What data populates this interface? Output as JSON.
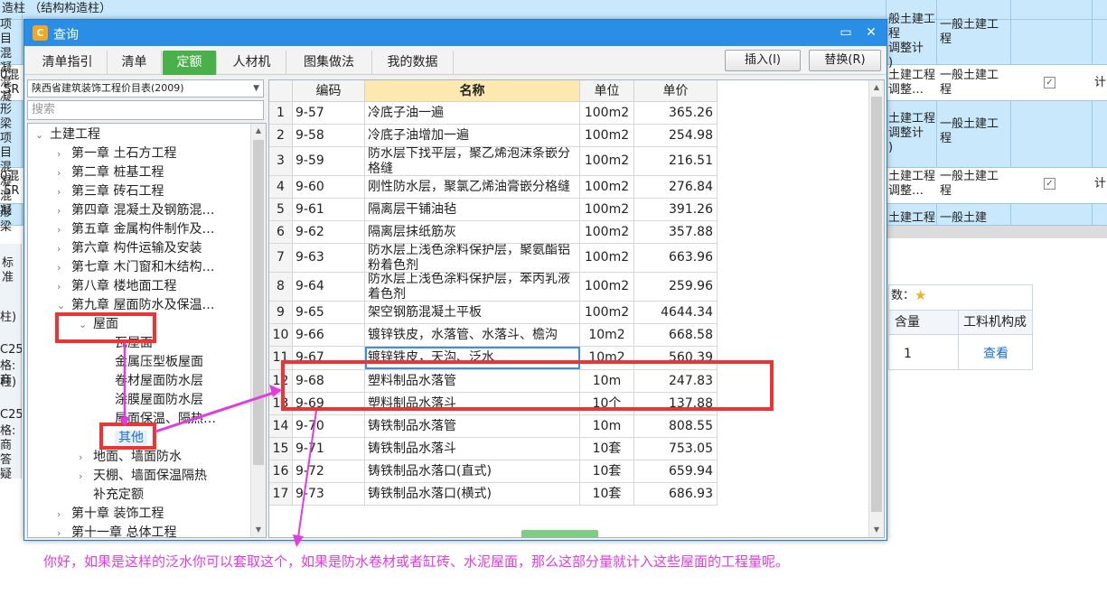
{
  "background": {
    "rows": [
      {
        "c1": "造柱  （结构构造柱）"
      },
      {
        "c1": "项目\n混凝\n混凝",
        "c2": "般土建工程\n调整计\n)",
        "c3": "一般土建工\n程"
      },
      {
        "c1": "0混\n.5R",
        "c2": "土建工程\n调整…",
        "c3": "一般土建工\n程",
        "check": "✓",
        "c4": "计"
      },
      {
        "c1": "形梁\n项目\n混凝\n混凝",
        "c2": "土建工程\n调整计\n)",
        "c3": "一般土建工\n程"
      },
      {
        "c1": "0混\n.5R",
        "c2": "土建工程\n调整…",
        "c3": "一般土建工\n程",
        "check": "✓",
        "c4": "计"
      },
      {
        "c1": "形梁",
        "c2": "土建工程",
        "c3": "一般土建"
      }
    ],
    "left_labels": [
      "标准",
      "柱)",
      "C25",
      "格:商",
      "柱)",
      "C25",
      "格:商",
      "答疑"
    ],
    "right_panel": {
      "title": "数：",
      "col_qty": "含量",
      "col_comp": "工料机构成",
      "qty_value": "1",
      "link": "查看"
    }
  },
  "dialog": {
    "title": "查询",
    "tabs": [
      "清单指引",
      "清单",
      "定额",
      "人材机",
      "图集做法",
      "我的数据"
    ],
    "active_tab": "定额",
    "insert_button": "插入(I)",
    "replace_button": "替换(R)",
    "library": "陕西省建筑装饰工程价目表(2009)",
    "search_placeholder": "搜索",
    "tree": [
      {
        "label": "土建工程",
        "level": 0,
        "expanded": true
      },
      {
        "label": "第一章  土石方工程",
        "level": 1
      },
      {
        "label": "第二章  桩基工程",
        "level": 1
      },
      {
        "label": "第三章  砖石工程",
        "level": 1
      },
      {
        "label": "第四章  混凝土及钢筋混…",
        "level": 1
      },
      {
        "label": "第五章  金属构件制作及…",
        "level": 1
      },
      {
        "label": "第六章  构件运输及安装",
        "level": 1
      },
      {
        "label": "第七章  木门窗和木结构…",
        "level": 1
      },
      {
        "label": "第八章  楼地面工程",
        "level": 1
      },
      {
        "label": "第九章  屋面防水及保温…",
        "level": 1,
        "expanded": true
      },
      {
        "label": "屋面",
        "level": 2,
        "expanded": true
      },
      {
        "label": "瓦屋面",
        "level": 3
      },
      {
        "label": "金属压型板屋面",
        "level": 3
      },
      {
        "label": "卷材屋面防水层",
        "level": 3
      },
      {
        "label": "涂膜屋面防水层",
        "level": 3
      },
      {
        "label": "屋面保温、隔热…",
        "level": 3
      },
      {
        "label": "其他",
        "level": 3,
        "selected": true
      },
      {
        "label": "地面、墙面防水",
        "level": 2
      },
      {
        "label": "天棚、墙面保温隔热",
        "level": 2
      },
      {
        "label": "补充定额",
        "level": 2
      },
      {
        "label": "第十章  装饰工程",
        "level": 1
      },
      {
        "label": "第十一章  总体工程",
        "level": 1
      }
    ],
    "table": {
      "headers": {
        "code": "编码",
        "name": "名称",
        "unit": "单位",
        "price": "单价"
      },
      "rows": [
        {
          "n": "1",
          "code": "9-57",
          "name": "冷底子油一遍",
          "unit": "100m2",
          "price": "365.26"
        },
        {
          "n": "2",
          "code": "9-58",
          "name": "冷底子油增加一遍",
          "unit": "100m2",
          "price": "254.98"
        },
        {
          "n": "3",
          "code": "9-59",
          "name": "防水层下找平层，聚乙烯泡沫条嵌分格缝",
          "unit": "100m2",
          "price": "216.51"
        },
        {
          "n": "4",
          "code": "9-60",
          "name": "刚性防水层，聚氯乙烯油膏嵌分格缝",
          "unit": "100m2",
          "price": "276.84"
        },
        {
          "n": "5",
          "code": "9-61",
          "name": "隔离层干铺油毡",
          "unit": "100m2",
          "price": "391.26"
        },
        {
          "n": "6",
          "code": "9-62",
          "name": "隔离层抹纸筋灰",
          "unit": "100m2",
          "price": "357.88"
        },
        {
          "n": "7",
          "code": "9-63",
          "name": "防水层上浅色涂料保护层，聚氨酯铝粉着色剂",
          "unit": "100m2",
          "price": "663.96"
        },
        {
          "n": "8",
          "code": "9-64",
          "name": "防水层上浅色涂料保护层，苯丙乳液着色剂",
          "unit": "100m2",
          "price": "259.96"
        },
        {
          "n": "9",
          "code": "9-65",
          "name": "架空钢筋混凝土平板",
          "unit": "100m2",
          "price": "4644.34"
        },
        {
          "n": "10",
          "code": "9-66",
          "name": "镀锌铁皮，水落管、水落斗、檐沟",
          "unit": "10m2",
          "price": "668.58"
        },
        {
          "n": "11",
          "code": "9-67",
          "name": "镀锌铁皮，天沟、泛水",
          "unit": "10m2",
          "price": "560.39",
          "selected": true
        },
        {
          "n": "12",
          "code": "9-68",
          "name": "塑料制品水落管",
          "unit": "10m",
          "price": "247.83"
        },
        {
          "n": "13",
          "code": "9-69",
          "name": "塑料制品水落斗",
          "unit": "10个",
          "price": "137.88"
        },
        {
          "n": "14",
          "code": "9-70",
          "name": "铸铁制品水落管",
          "unit": "10m",
          "price": "808.55"
        },
        {
          "n": "15",
          "code": "9-71",
          "name": "铸铁制品水落斗",
          "unit": "10套",
          "price": "753.05"
        },
        {
          "n": "16",
          "code": "9-72",
          "name": "铸铁制品水落口(直式)",
          "unit": "10套",
          "price": "659.94"
        },
        {
          "n": "17",
          "code": "9-73",
          "name": "铸铁制品水落口(横式)",
          "unit": "10套",
          "price": "686.93"
        }
      ]
    }
  },
  "annotation": {
    "note": "你好，如果是这样的泛水你可以套取这个，如果是防水卷材或者缸砖、水泥屋面，那么这部分量就计入这些屋面的工程量呢。",
    "color": "#e23be0",
    "box_color": "#ee3333"
  }
}
